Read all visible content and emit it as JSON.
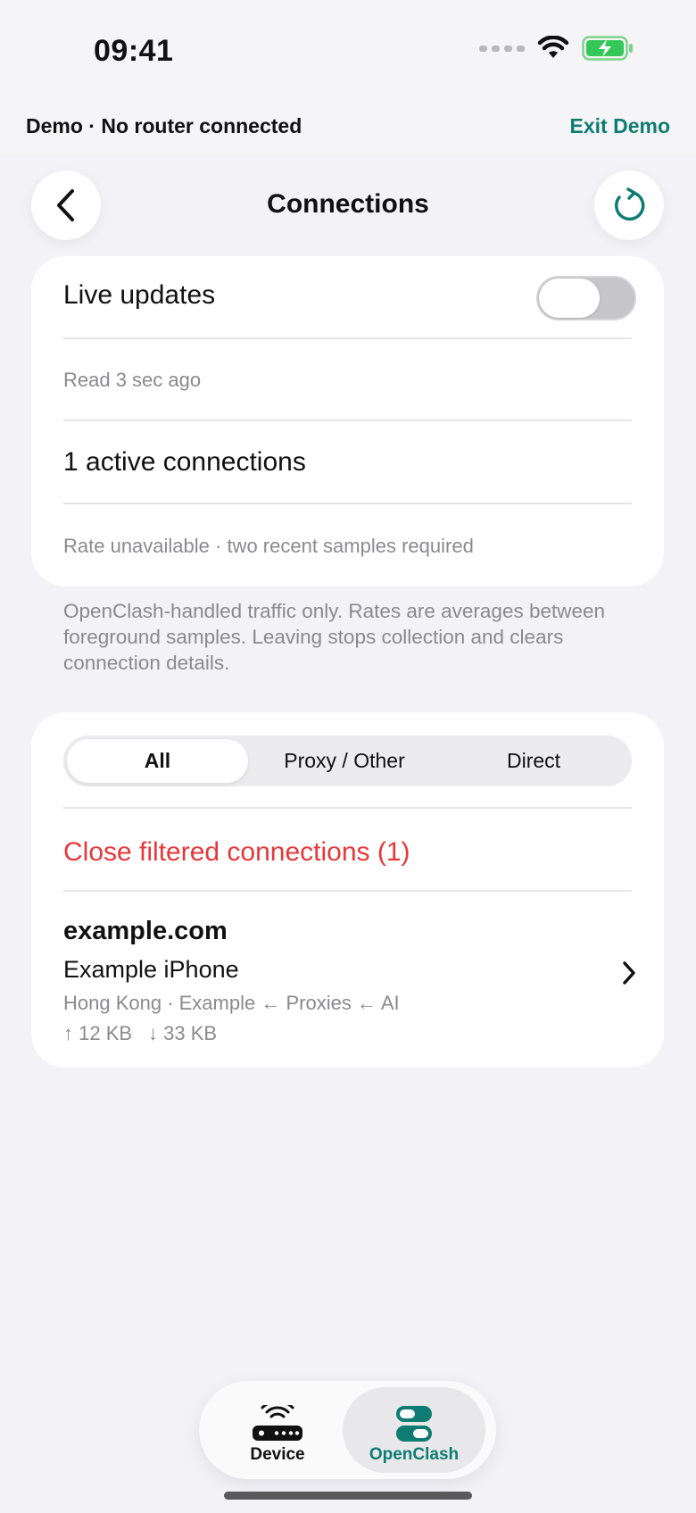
{
  "status_bar": {
    "time": "09:41"
  },
  "demo_bar": {
    "text": "Demo · No router connected",
    "exit_label": "Exit Demo"
  },
  "header": {
    "title": "Connections"
  },
  "live_card": {
    "live_label": "Live updates",
    "live_enabled": false,
    "read_text": "Read 3 sec ago",
    "active_text": "1 active connections",
    "rate_text": "Rate unavailable · two recent samples required"
  },
  "footnote": "OpenClash-handled traffic only. Rates are averages between foreground samples. Leaving stops collection and clears connection details.",
  "filters": {
    "tabs": [
      "All",
      "Proxy / Other",
      "Direct"
    ],
    "selected": "All",
    "close_label": "Close filtered connections (1)"
  },
  "connections": [
    {
      "host": "example.com",
      "device": "Example iPhone",
      "route": "Hong Kong · Example ← Proxies ← AI",
      "upload": "↑ 12 KB",
      "download": "↓ 33 KB"
    }
  ],
  "tabbar": {
    "items": [
      {
        "label": "Device",
        "icon": "router-icon"
      },
      {
        "label": "OpenClash",
        "icon": "toggles-icon"
      }
    ],
    "selected": "OpenClash"
  },
  "colors": {
    "accent": "#0e7c72",
    "destructive": "#e5383b",
    "background": "#f2f2f7"
  }
}
